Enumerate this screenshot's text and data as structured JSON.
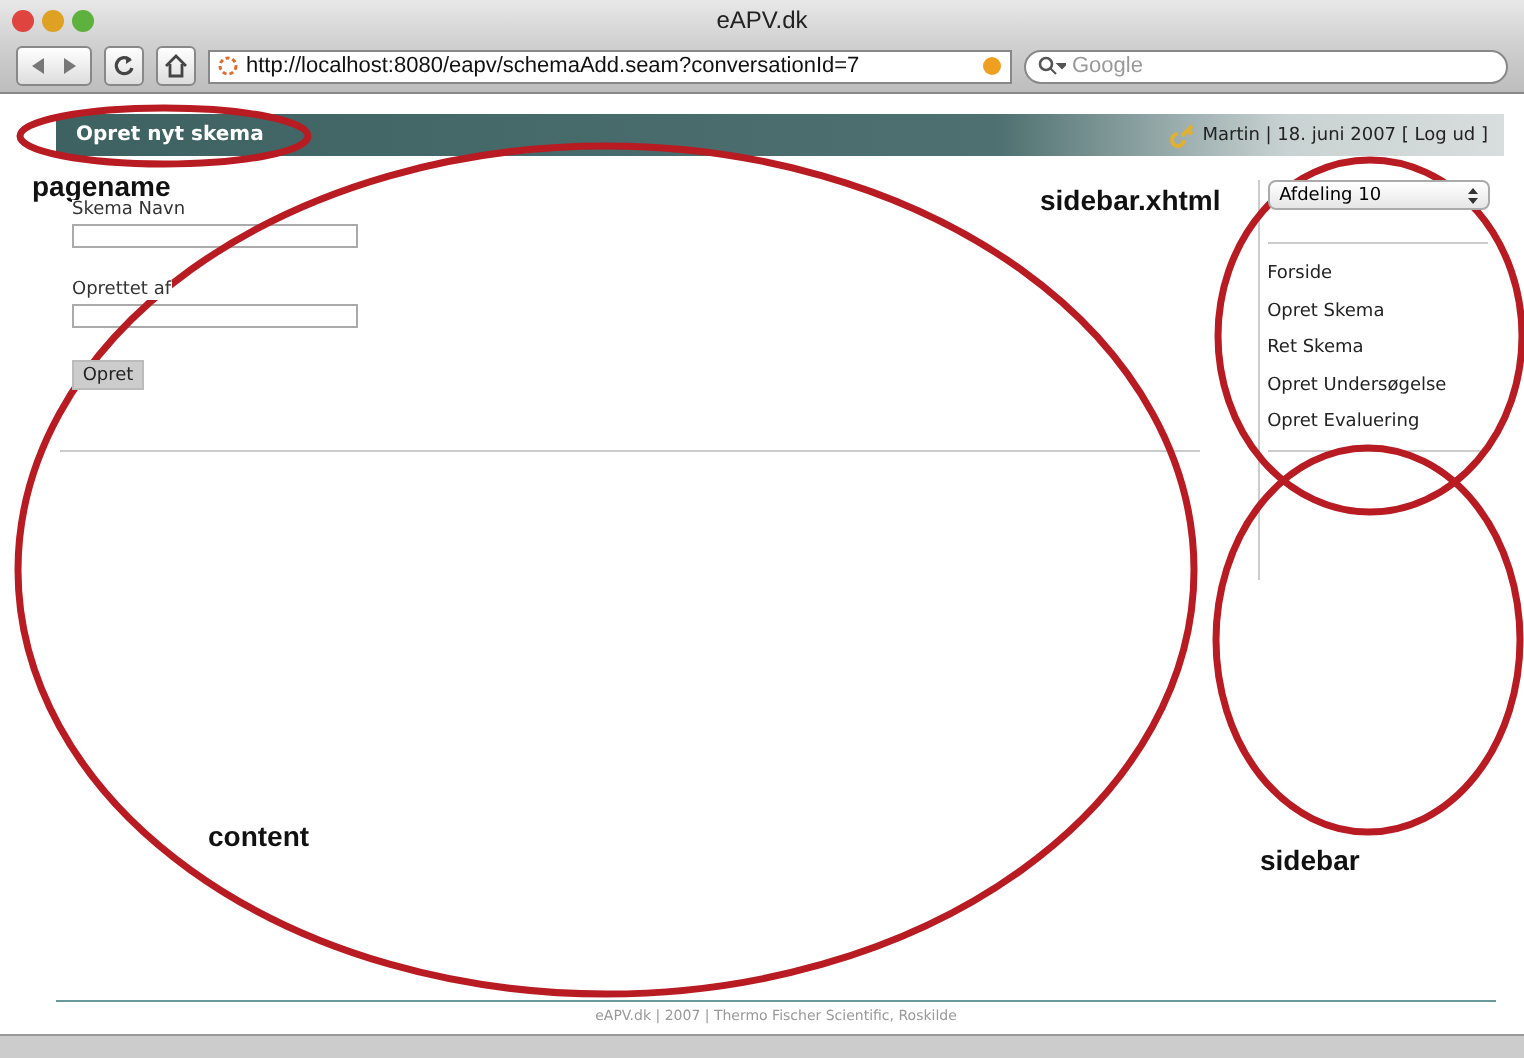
{
  "window": {
    "title": "eAPV.dk"
  },
  "toolbar": {
    "url": "http://localhost:8080/eapv/schemaAdd.seam?conversationId=7",
    "search_placeholder": "Google"
  },
  "header": {
    "page_title": "Opret nyt skema",
    "user_info": "Martin | 18. juni 2007 [ Log ud ]"
  },
  "form": {
    "fields": [
      {
        "label": "Skema Navn"
      },
      {
        "label": "Oprettet af"
      }
    ],
    "submit": "Opret"
  },
  "sidebar": {
    "select": "Afdeling 10",
    "links": [
      "Forside",
      "Opret Skema",
      "Ret Skema",
      "Opret Undersøgelse",
      "Opret Evaluering"
    ]
  },
  "footer": "eAPV.dk | 2007 | Thermo Fischer Scientific, Roskilde",
  "annotations": [
    {
      "label": "pagename"
    },
    {
      "label": "sidebar.xhtml"
    },
    {
      "label": "content"
    },
    {
      "label": "sidebar"
    }
  ]
}
